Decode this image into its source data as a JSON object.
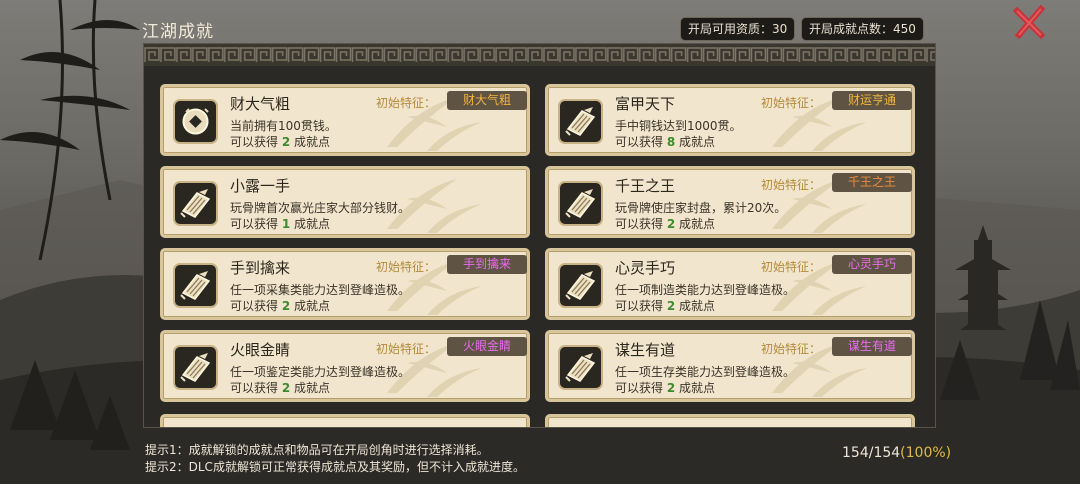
{
  "header": {
    "title": "江湖成就",
    "stat_qualification": "开局可用资质：30",
    "stat_points": "开局成就点数：450"
  },
  "labels": {
    "trait_label": "初始特征：",
    "reward_prefix": "可以获得",
    "reward_suffix": "成就点"
  },
  "achievements": [
    {
      "name": "财大气粗",
      "desc": "当前拥有100贯钱。",
      "points": "2",
      "trait": "财大气粗",
      "trait_color": "gold",
      "icon": "coin-icon"
    },
    {
      "name": "富甲天下",
      "desc": "手中铜钱达到1000贯。",
      "points": "8",
      "trait": "财运亨通",
      "trait_color": "gold",
      "icon": "scroll-icon"
    },
    {
      "name": "小露一手",
      "desc": "玩骨牌首次赢光庄家大部分钱财。",
      "points": "1",
      "trait": "",
      "trait_color": "",
      "icon": "scroll-icon"
    },
    {
      "name": "千王之王",
      "desc": "玩骨牌使庄家封盘，累计20次。",
      "points": "2",
      "trait": "千王之王",
      "trait_color": "orange",
      "icon": "scroll-icon"
    },
    {
      "name": "手到擒来",
      "desc": "任一项采集类能力达到登峰造极。",
      "points": "2",
      "trait": "手到擒来",
      "trait_color": "purple",
      "icon": "scroll-icon"
    },
    {
      "name": "心灵手巧",
      "desc": "任一项制造类能力达到登峰造极。",
      "points": "2",
      "trait": "心灵手巧",
      "trait_color": "purple",
      "icon": "scroll-icon"
    },
    {
      "name": "火眼金睛",
      "desc": "任一项鉴定类能力达到登峰造极。",
      "points": "2",
      "trait": "火眼金睛",
      "trait_color": "purple",
      "icon": "scroll-icon"
    },
    {
      "name": "谋生有道",
      "desc": "任一项生存类能力达到登峰造极。",
      "points": "2",
      "trait": "谋生有道",
      "trait_color": "purple",
      "icon": "scroll-icon"
    }
  ],
  "footer": {
    "hint1": "提示1：成就解锁的成就点和物品可在开局创角时进行选择消耗。",
    "hint2": "提示2：DLC成就解锁可正常获得成就点及其奖励，但不计入成就进度。",
    "progress_count": "154/154",
    "progress_pct": "(100%)"
  },
  "colors": {
    "gold": "#f2b53b",
    "purple": "#ea6cf0",
    "orange": "#f08b3b",
    "close": "#c8333a"
  }
}
